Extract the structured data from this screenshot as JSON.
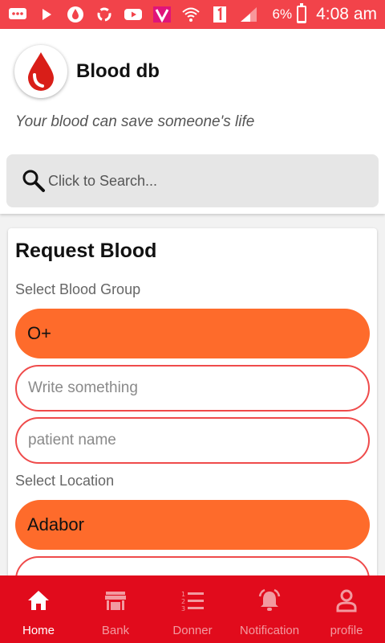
{
  "status_bar": {
    "battery": "6%",
    "time": "4:08 am",
    "battery_level": 0.06
  },
  "header": {
    "title": "Blood db",
    "tagline": "Your blood can save someone's life"
  },
  "search": {
    "placeholder": "Click to Search..."
  },
  "form": {
    "title": "Request Blood",
    "blood_group_label": "Select Blood Group",
    "blood_group_value": "O+",
    "message_placeholder": "Write something",
    "patient_placeholder": "patient name",
    "location_label": "Select Location",
    "location_value": "Adabor"
  },
  "nav": {
    "items": [
      {
        "label": "Home",
        "icon": "home-icon"
      },
      {
        "label": "Bank",
        "icon": "store-icon"
      },
      {
        "label": "Donner",
        "icon": "list-icon"
      },
      {
        "label": "Notification",
        "icon": "alarm-icon"
      },
      {
        "label": "profile",
        "icon": "person-icon"
      }
    ],
    "active": "Home"
  },
  "colors": {
    "status_bar": "#f2434a",
    "accent_orange": "#fe6b2b",
    "nav_bg": "#e10b1c",
    "outline_red": "#ef4b4b"
  }
}
